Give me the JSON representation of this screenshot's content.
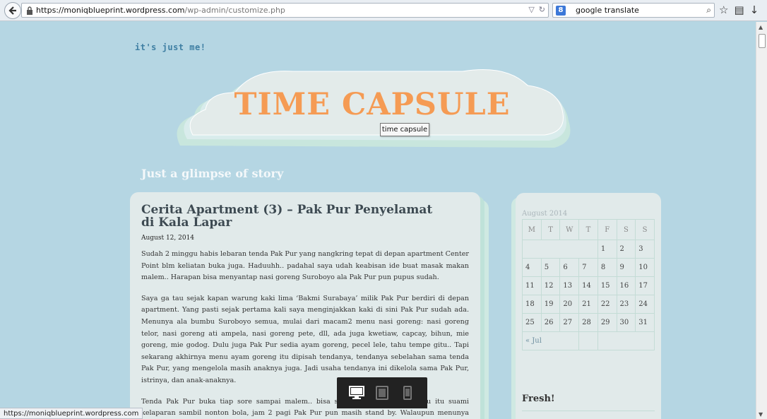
{
  "browser": {
    "url_host": "https://moniqblueprint.wordpress.com",
    "url_path": "/wp-admin/customize.php",
    "search_query": "google translate",
    "search_engine_badge": "8",
    "status_url": "https://moniqblueprint.wordpress.com"
  },
  "site": {
    "tagline_top": "it's just me!",
    "title": "TIME CAPSULE",
    "tooltip": "time capsule",
    "description": "Just a glimpse of story"
  },
  "post": {
    "title": "Cerita Apartment (3) – Pak Pur Penyelamat di Kala Lapar",
    "date": "August 12, 2014",
    "paragraphs": [
      "Sudah 2 minggu habis lebaran tenda Pak Pur yang nangkring tepat di depan apartment Center Point blm keliatan buka juga. Haduuhh.. padahal saya udah keabisan ide buat masak makan malem.. Harapan bisa menyantap nasi goreng Suroboyo ala Pak Pur pun pupus sudah.",
      "Saya ga tau sejak kapan warung kaki lima ‘Bakmi Surabaya’ milik Pak Pur berdiri di depan apartment. Yang pasti sejak pertama kali saya menginjakkan kaki di sini Pak Pur sudah ada. Menunya ala bumbu Suroboyo semua, mulai dari macam2 menu nasi goreng: nasi goreng telor, nasi goreng ati ampela, nasi goreng pete, dll, ada juga kwetiaw, capcay, bihun, mie goreng, mie godog. Dulu juga Pak Pur sedia ayam goreng, pecel lele, tahu tempe gitu.. Tapi sekarang akhirnya menu ayam goreng itu dipisah tendanya, tendanya sebelahan sama tenda Pak Pur, yang mengelola masih anaknya juga. Jadi usaha tendanya ini dikelola sama Pak Pur, istrinya, dan anak-anaknya.",
      "Tenda Pak Pur buka tiap sore sampai malem.. bisa sampai pagi malah. Waktu itu suami kelaparan sambil nonton bola, jam 2 pagi Pak Pur pun masih stand by. Walaupun menunya sederhana tapi kami"
    ]
  },
  "calendar": {
    "caption": "August 2014",
    "weekdays": [
      "M",
      "T",
      "W",
      "T",
      "F",
      "S",
      "S"
    ],
    "weeks": [
      [
        "",
        "",
        "",
        "",
        "1",
        "2",
        "3"
      ],
      [
        "4",
        "5",
        "6",
        "7",
        "8",
        "9",
        "10"
      ],
      [
        "11",
        "12",
        "13",
        "14",
        "15",
        "16",
        "17"
      ],
      [
        "18",
        "19",
        "20",
        "21",
        "22",
        "23",
        "24"
      ],
      [
        "25",
        "26",
        "27",
        "28",
        "29",
        "30",
        "31"
      ]
    ],
    "prev_link": "« Jul"
  },
  "sidebar": {
    "fresh_heading": "Fresh!"
  },
  "icons": {
    "back": "back-arrow-icon",
    "lock": "lock-icon",
    "reload": "reload-icon",
    "search": "search-icon",
    "bookmark": "star-icon",
    "library": "clipboard-icon",
    "download": "download-icon",
    "desktop": "desktop-icon",
    "tablet": "tablet-icon",
    "mobile": "mobile-icon"
  },
  "colors": {
    "page_bg": "#b5d6e3",
    "title_orange": "#f59b54",
    "card_bg": "#e1eaea",
    "card_shadow": "#bfe2d9"
  }
}
